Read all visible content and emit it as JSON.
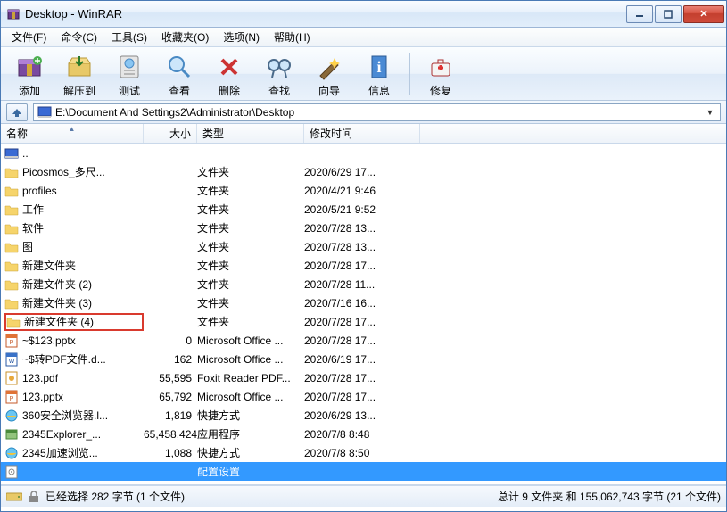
{
  "window": {
    "title": "Desktop - WinRAR"
  },
  "menu": [
    "文件(F)",
    "命令(C)",
    "工具(S)",
    "收藏夹(O)",
    "选项(N)",
    "帮助(H)"
  ],
  "toolbar": [
    {
      "label": "添加",
      "icon": "add"
    },
    {
      "label": "解压到",
      "icon": "extract"
    },
    {
      "label": "测试",
      "icon": "test"
    },
    {
      "label": "查看",
      "icon": "view"
    },
    {
      "label": "删除",
      "icon": "delete"
    },
    {
      "label": "查找",
      "icon": "find"
    },
    {
      "label": "向导",
      "icon": "wizard"
    },
    {
      "label": "信息",
      "icon": "info"
    },
    {
      "label": "修复",
      "icon": "repair"
    }
  ],
  "address": "E:\\Document And Settings2\\Administrator\\Desktop",
  "columns": {
    "name": "名称",
    "size": "大小",
    "type": "类型",
    "date": "修改时间"
  },
  "files": [
    {
      "icon": "up",
      "name": "..",
      "size": "",
      "type": "",
      "date": ""
    },
    {
      "icon": "folder",
      "name": "Picosmos_多尺...",
      "size": "",
      "type": "文件夹",
      "date": "2020/6/29 17..."
    },
    {
      "icon": "folder",
      "name": "profiles",
      "size": "",
      "type": "文件夹",
      "date": "2020/4/21 9:46"
    },
    {
      "icon": "folder",
      "name": "工作",
      "size": "",
      "type": "文件夹",
      "date": "2020/5/21 9:52"
    },
    {
      "icon": "folder",
      "name": "软件",
      "size": "",
      "type": "文件夹",
      "date": "2020/7/28 13..."
    },
    {
      "icon": "folder",
      "name": "图",
      "size": "",
      "type": "文件夹",
      "date": "2020/7/28 13..."
    },
    {
      "icon": "folder",
      "name": "新建文件夹",
      "size": "",
      "type": "文件夹",
      "date": "2020/7/28 17..."
    },
    {
      "icon": "folder",
      "name": "新建文件夹 (2)",
      "size": "",
      "type": "文件夹",
      "date": "2020/7/28 11..."
    },
    {
      "icon": "folder",
      "name": "新建文件夹 (3)",
      "size": "",
      "type": "文件夹",
      "date": "2020/7/16 16..."
    },
    {
      "icon": "folder",
      "name": "新建文件夹 (4)",
      "size": "",
      "type": "文件夹",
      "date": "2020/7/28 17...",
      "highlight": true
    },
    {
      "icon": "pptx",
      "name": "~$123.pptx",
      "size": "0",
      "type": "Microsoft Office ...",
      "date": "2020/7/28 17..."
    },
    {
      "icon": "docx",
      "name": "~$转PDF文件.d...",
      "size": "162",
      "type": "Microsoft Office ...",
      "date": "2020/6/19 17..."
    },
    {
      "icon": "pdf",
      "name": "123.pdf",
      "size": "55,595",
      "type": "Foxit Reader PDF...",
      "date": "2020/7/28 17..."
    },
    {
      "icon": "pptx",
      "name": "123.pptx",
      "size": "65,792",
      "type": "Microsoft Office ...",
      "date": "2020/7/28 17..."
    },
    {
      "icon": "ie",
      "name": "360安全浏览器.l...",
      "size": "1,819",
      "type": "快捷方式",
      "date": "2020/6/29 13..."
    },
    {
      "icon": "exe",
      "name": "2345Explorer_...",
      "size": "65,458,424",
      "type": "应用程序",
      "date": "2020/7/8 8:48"
    },
    {
      "icon": "ie",
      "name": "2345加速浏览...",
      "size": "1,088",
      "type": "快捷方式",
      "date": "2020/7/8 8:50"
    },
    {
      "icon": "cfg",
      "name": "",
      "size": "",
      "type": "配置设置",
      "date": "",
      "selected": true
    }
  ],
  "status": {
    "left": "已经选择 282 字节 (1 个文件)",
    "right": "总计 9 文件夹 和 155,062,743 字节 (21 个文件)"
  }
}
